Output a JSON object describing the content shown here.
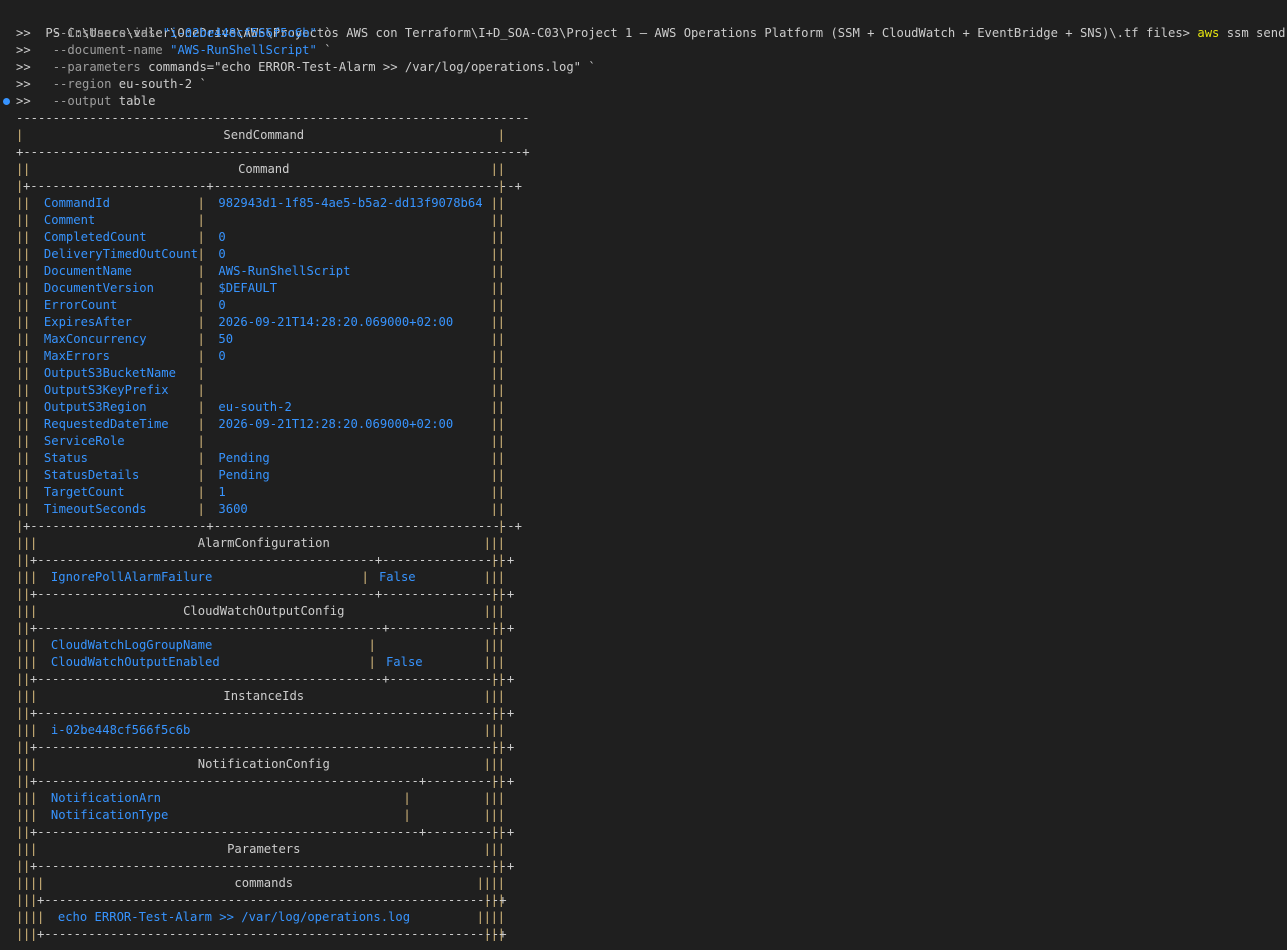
{
  "prompt": {
    "text": "PS C:\\Users\\valer\\OneDrive\\AWS\\Proyectos AWS con Terraform\\I+D_SOA-C03\\Project 1 – AWS Operations Platform (SSM + CloudWatch + EventBridge + SNS)\\.tf files> ",
    "cmd": "aws",
    "args": " ssm send-command `"
  },
  "continuation": [
    {
      "marker": ">>",
      "param": "--instance-ids",
      "value": "\"i-02be448cf566f5c6b\"",
      "tail": " `"
    },
    {
      "marker": ">>",
      "param": "--document-name",
      "value": "\"AWS-RunShellScript\"",
      "tail": " `"
    },
    {
      "marker": ">>",
      "param": "--parameters",
      "value": "commands=\"echo ERROR-Test-Alarm >> /var/log/operations.log\"",
      "tail": " `"
    },
    {
      "marker": ">>",
      "param": "--region",
      "value": "eu-south-2",
      "tail": " `"
    },
    {
      "marker": ">>",
      "param": "--output",
      "value": "table",
      "tail": ""
    }
  ],
  "table": {
    "title": "SendCommand",
    "command_title": "Command",
    "command_rows": [
      {
        "key": "CommandId",
        "value": "982943d1-1f85-4ae5-b5a2-dd13f9078b64"
      },
      {
        "key": "Comment",
        "value": ""
      },
      {
        "key": "CompletedCount",
        "value": "0"
      },
      {
        "key": "DeliveryTimedOutCount",
        "value": "0"
      },
      {
        "key": "DocumentName",
        "value": "AWS-RunShellScript"
      },
      {
        "key": "DocumentVersion",
        "value": "$DEFAULT"
      },
      {
        "key": "ErrorCount",
        "value": "0"
      },
      {
        "key": "ExpiresAfter",
        "value": "2026-09-21T14:28:20.069000+02:00"
      },
      {
        "key": "MaxConcurrency",
        "value": "50"
      },
      {
        "key": "MaxErrors",
        "value": "0"
      },
      {
        "key": "OutputS3BucketName",
        "value": ""
      },
      {
        "key": "OutputS3KeyPrefix",
        "value": ""
      },
      {
        "key": "OutputS3Region",
        "value": "eu-south-2"
      },
      {
        "key": "RequestedDateTime",
        "value": "2026-09-21T12:28:20.069000+02:00"
      },
      {
        "key": "ServiceRole",
        "value": ""
      },
      {
        "key": "Status",
        "value": "Pending"
      },
      {
        "key": "StatusDetails",
        "value": "Pending"
      },
      {
        "key": "TargetCount",
        "value": "1"
      },
      {
        "key": "TimeoutSeconds",
        "value": "3600"
      }
    ],
    "alarm": {
      "title": "AlarmConfiguration",
      "rows": [
        {
          "key": "IgnorePollAlarmFailure",
          "value": "False"
        }
      ]
    },
    "cloudwatch": {
      "title": "CloudWatchOutputConfig",
      "rows": [
        {
          "key": "CloudWatchLogGroupName",
          "value": ""
        },
        {
          "key": "CloudWatchOutputEnabled",
          "value": "False"
        }
      ]
    },
    "instances": {
      "title": "InstanceIds",
      "rows": [
        "i-02be448cf566f5c6b"
      ]
    },
    "notification": {
      "title": "NotificationConfig",
      "rows": [
        {
          "key": "NotificationArn",
          "value": ""
        },
        {
          "key": "NotificationType",
          "value": ""
        }
      ]
    },
    "parameters": {
      "title": "Parameters",
      "sub_title": "commands",
      "rows": [
        "echo ERROR-Test-Alarm >> /var/log/operations.log"
      ]
    }
  },
  "colors": {
    "background": "#1f1f1f",
    "text": "#cccccc",
    "table_keys": "#3794ff",
    "border_pipes": "#d7ba7d",
    "command_name": "#e5e510",
    "gutter_dot": "#3794ff"
  }
}
